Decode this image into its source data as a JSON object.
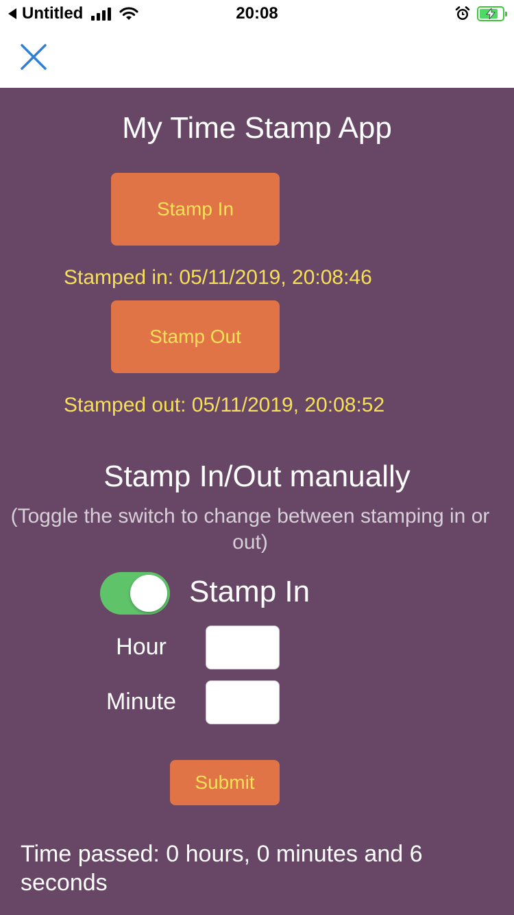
{
  "status_bar": {
    "back_app": "Untitled",
    "time": "20:08",
    "signal_bars": 4,
    "battery_level": 0.8,
    "icons": [
      "back-arrow-icon",
      "signal-icon",
      "wifi-icon",
      "alarm-icon",
      "battery-charging-icon"
    ]
  },
  "nav": {
    "close_icon": "close-icon"
  },
  "app": {
    "title": "My Time Stamp App",
    "stamp_in_button": "Stamp In",
    "stamped_in_text": "Stamped in: 05/11/2019, 20:08:46",
    "stamp_out_button": "Stamp Out",
    "stamped_out_text": "Stamped out: 05/11/2019, 20:08:52"
  },
  "manual": {
    "title": "Stamp In/Out manually",
    "subtitle": "(Toggle the switch to change between stamping in or out)",
    "toggle_on": true,
    "toggle_label": "Stamp In",
    "hour_label": "Hour",
    "hour_value": "",
    "minute_label": "Minute",
    "minute_value": "",
    "submit_button": "Submit"
  },
  "result": {
    "time_passed": "Time passed: 0 hours, 0 minutes and 6 seconds"
  },
  "colors": {
    "background": "#684666",
    "button": "#e07447",
    "button_text": "#f6e05a",
    "toggle_on": "#5fc36a",
    "close_icon": "#2f7fd6"
  }
}
